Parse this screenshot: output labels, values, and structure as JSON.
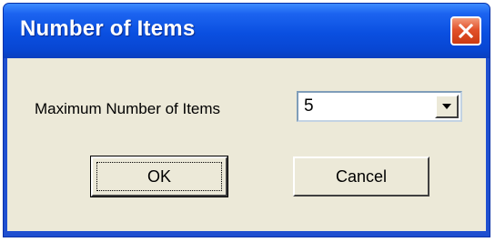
{
  "window": {
    "title": "Number of Items"
  },
  "icons": {
    "close": "close-icon",
    "dropdown": "chevron-down-icon"
  },
  "form": {
    "max_items_label": "Maximum Number of Items",
    "max_items_value": "5"
  },
  "buttons": {
    "ok_label": "OK",
    "cancel_label": "Cancel"
  },
  "colors": {
    "titlebar": "#0a4fe0",
    "client_background": "#ece9d8",
    "close_button": "#e2522b"
  }
}
